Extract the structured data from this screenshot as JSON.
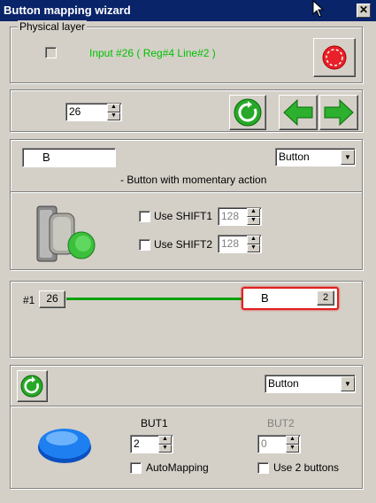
{
  "window": {
    "title": "Button mapping wizard",
    "close_glyph": "✕"
  },
  "physical_layer": {
    "group_label": "Physical layer",
    "input_info": "Input #26  ( Reg#4  Line#2 )",
    "colors": {
      "input_info": "#00c000",
      "stop_button": "#e8202a"
    }
  },
  "navigation": {
    "input_number": "26"
  },
  "config": {
    "name_value": "B",
    "type_select": "Button",
    "description": "- Button with momentary action",
    "shift1": {
      "label": "Use SHIFT1",
      "value": "128",
      "checked": false
    },
    "shift2": {
      "label": "Use SHIFT2",
      "value": "128",
      "checked": false
    }
  },
  "mapping": {
    "source_label": "#1",
    "source_value": "26",
    "target_name": "B",
    "target_index": "2",
    "colors": {
      "line": "#00a000",
      "target_border": "#e02020"
    }
  },
  "output": {
    "type_select": "Button",
    "but1": {
      "label": "BUT1",
      "value": "2"
    },
    "but2": {
      "label": "BUT2",
      "value": "0"
    },
    "automapping_label": "AutoMapping",
    "use2buttons_label": "Use 2 buttons",
    "colors": {
      "button_image": "#1e7ff0"
    }
  },
  "icons": {
    "refresh": "refresh-icon",
    "back": "arrow-left-icon",
    "forward": "arrow-right-icon",
    "stop": "stop-icon",
    "dropdown": "chevron-down-icon"
  }
}
